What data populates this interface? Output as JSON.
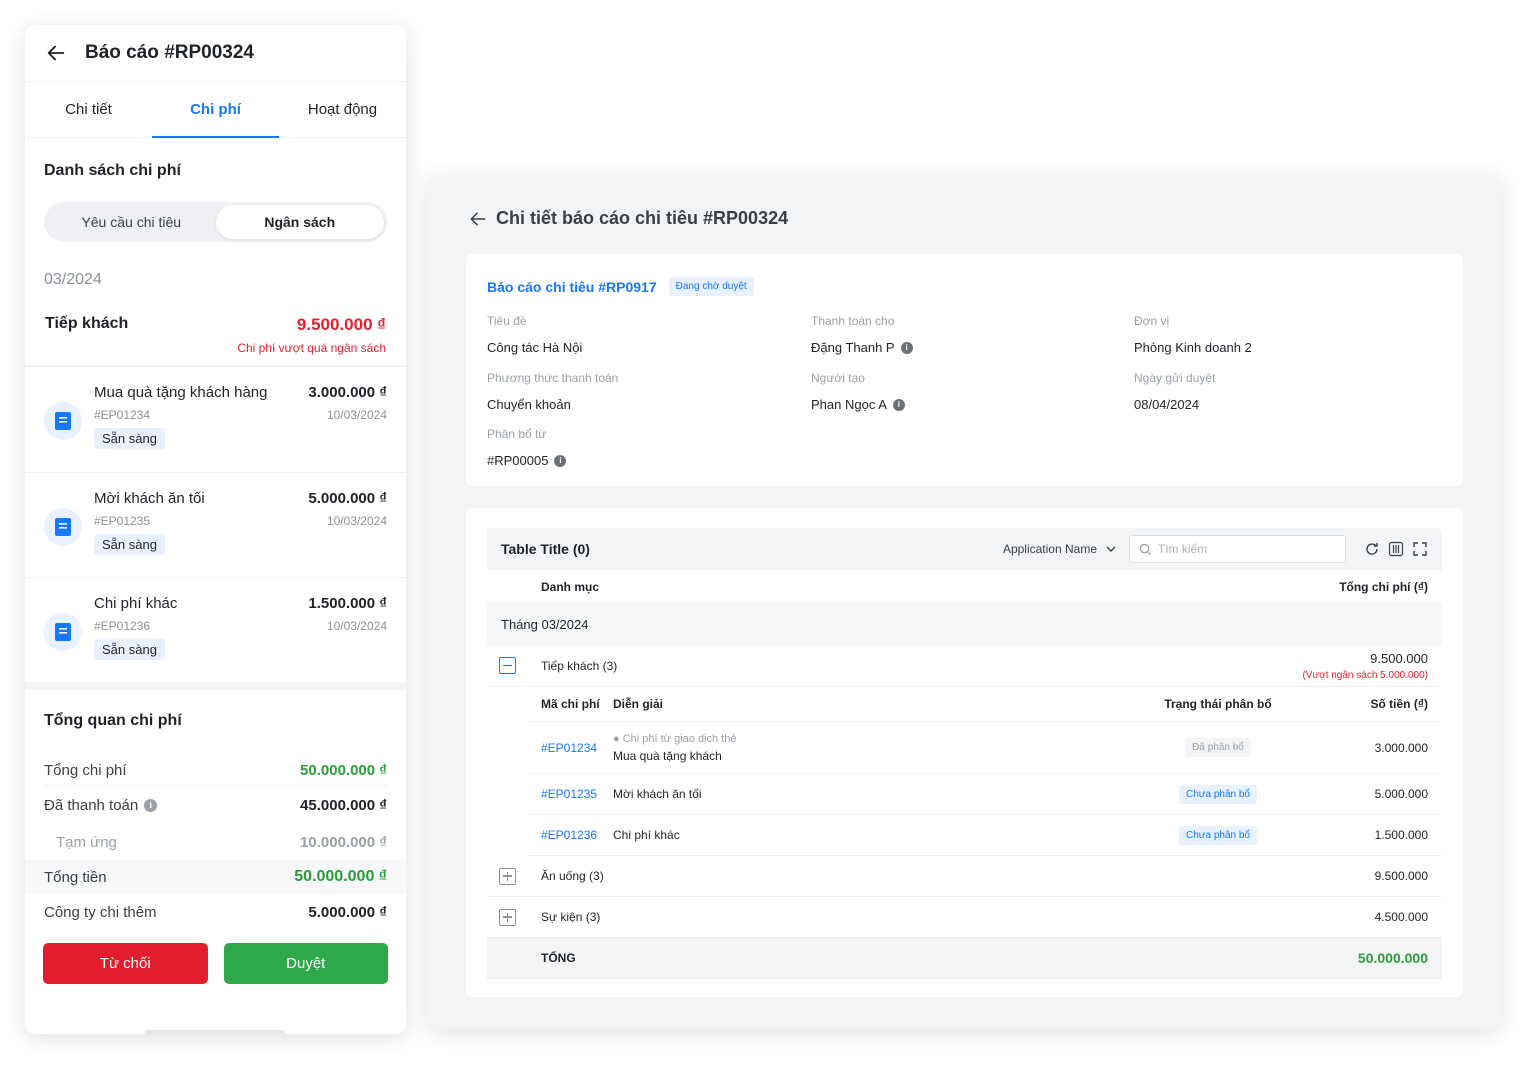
{
  "mobile": {
    "title": "Báo cáo #RP00324",
    "tabs": [
      "Chi tiết",
      "Chi phí",
      "Hoạt động"
    ],
    "section_title": "Danh sách chi phí",
    "segments": [
      "Yêu cầu chi tiêu",
      "Ngân sách"
    ],
    "month": "03/2024",
    "category": {
      "name": "Tiếp khách",
      "amount": "9.500.000 ₫",
      "warning": "Chi phí vượt quá ngân sách"
    },
    "items": [
      {
        "name": "Mua quà tặng khách hàng",
        "amount": "3.000.000 ₫",
        "code": "#EP01234",
        "date": "10/03/2024",
        "status": "Sẵn sàng"
      },
      {
        "name": "Mời khách ăn tối",
        "amount": "5.000.000 ₫",
        "code": "#EP01235",
        "date": "10/03/2024",
        "status": "Sẵn sàng"
      },
      {
        "name": "Chi phí khác",
        "amount": "1.500.000 ₫",
        "code": "#EP01236",
        "date": "10/03/2024",
        "status": "Sẵn sàng"
      }
    ],
    "overview": {
      "title": "Tổng quan chi phí",
      "total_cost_label": "Tổng chi phí",
      "total_cost": "50.000.000 ₫",
      "paid_label": "Đã thanh toán",
      "paid": "45.000.000 ₫",
      "advance_label": "Tạm ứng",
      "advance": "10.000.000 ₫",
      "total_label": "Tổng tiền",
      "total": "50.000.000 ₫",
      "extra_label": "Công ty chi thêm",
      "extra": "5.000.000 ₫"
    },
    "reject_label": "Từ chối",
    "approve_label": "Duyệt"
  },
  "desktop": {
    "title": "Chi tiết báo cáo chi tiêu #RP00324",
    "report_link": "Báo cáo chi tiêu #RP0917",
    "report_status": "Đang chờ duyệt",
    "fields": {
      "subject_label": "Tiêu đề",
      "subject": "Công tác Hà Nội",
      "payee_label": "Thanh toán cho",
      "payee": "Đặng Thanh P",
      "unit_label": "Đơn vị",
      "unit": "Phòng Kinh doanh 2",
      "method_label": "Phương thức thanh toán",
      "method": "Chuyển khoản",
      "creator_label": "Người tạo",
      "creator": "Phan Ngọc A",
      "sent_label": "Ngày gửi duyệt",
      "sent": "08/04/2024",
      "alloc_label": "Phân bổ từ",
      "alloc": "#RP00005"
    },
    "table": {
      "title": "Table Title (0)",
      "app_name": "Application Name",
      "search_placeholder": "Tìm kiếm",
      "col_category": "Danh mục",
      "col_total": "Tổng chi phí (₫)",
      "month_row": "Tháng 03/2024",
      "group1": {
        "name": "Tiếp khách (3)",
        "amount": "9.500.000",
        "warning": "(Vượt  ngân sách 5.000.000)"
      },
      "sub_headers": {
        "code": "Mã chi phí",
        "desc": "Diễn giải",
        "status": "Trạng thái phân bổ",
        "amount": "Số tiền (₫)"
      },
      "rows": [
        {
          "code": "#EP01234",
          "note": "Chi phí từ giao dịch thẻ",
          "desc": "Mua quà tặng khách",
          "status": "Đã phân bổ",
          "amount": "3.000.000"
        },
        {
          "code": "#EP01235",
          "desc": "Mời khách ăn tối",
          "status": "Chưa phân bổ",
          "amount": "5.000.000"
        },
        {
          "code": "#EP01236",
          "desc": "Chi phí khác",
          "status": "Chưa phân bổ",
          "amount": "1.500.000"
        }
      ],
      "group2": {
        "name": "Ăn uống (3)",
        "amount": "9.500.000"
      },
      "group3": {
        "name": "Sự kiện (3)",
        "amount": "4.500.000"
      },
      "total_label": "TỔNG",
      "total_amount": "50.000.000"
    }
  },
  "colors": {
    "primary": "#1677ff",
    "danger": "#e21d2e",
    "success": "#2ea84a"
  }
}
